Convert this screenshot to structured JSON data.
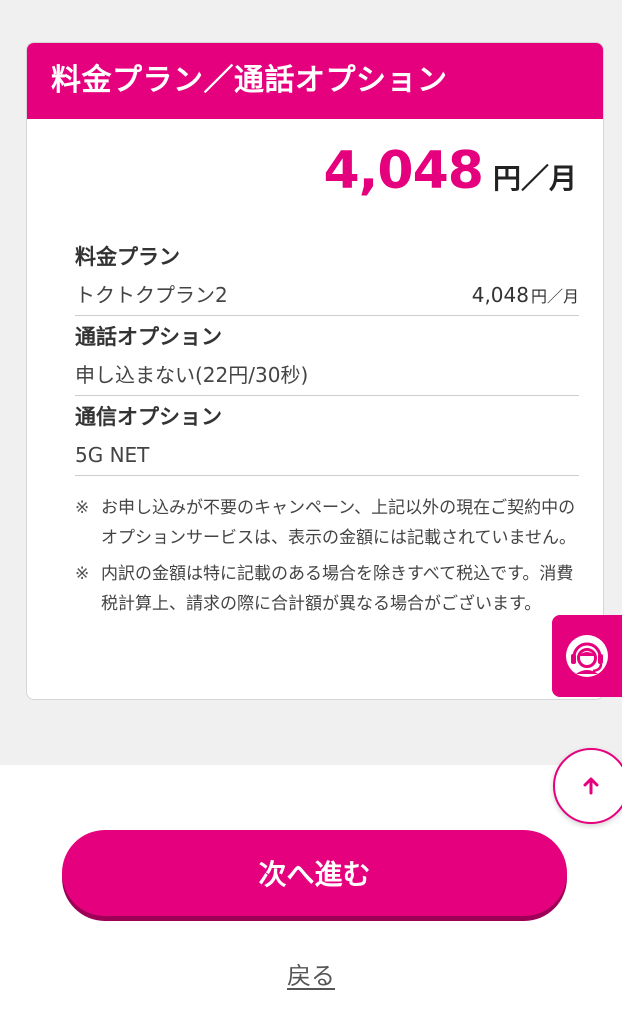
{
  "card": {
    "title": "料金プラン／通話オプション",
    "total": {
      "amount": "4,048",
      "unit": "円／月"
    },
    "sections": [
      {
        "label": "料金プラン",
        "value": "トクトクプラン2",
        "price": "4,048",
        "price_unit": "円／月"
      },
      {
        "label": "通話オプション",
        "value": "申し込まない(22円/30秒)"
      },
      {
        "label": "通信オプション",
        "value": "5G NET"
      }
    ],
    "notes": [
      {
        "mark": "※",
        "text": "お申し込みが不要のキャンペーン、上記以外の現在ご契約中のオプションサービスは、表示の金額には記載されていません。"
      },
      {
        "mark": "※",
        "text": "内訳の金額は特に記載のある場合を除きすべて税込です。消費税計算上、請求の際に合計額が異なる場合がございます。"
      }
    ]
  },
  "icons": {
    "support": "headset-support-icon",
    "scroll_top": "arrow-up-icon"
  },
  "colors": {
    "accent": "#e5007e",
    "accent_shadow": "#9e0058",
    "background_gray": "#f0f0f0"
  },
  "actions": {
    "next_label": "次へ進む",
    "back_label": "戻る"
  }
}
